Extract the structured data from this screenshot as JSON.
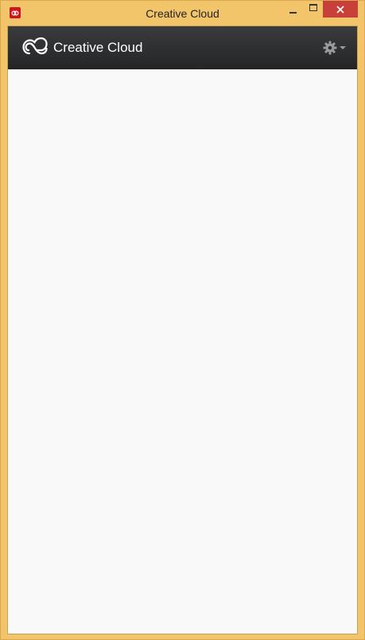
{
  "window": {
    "title": "Creative Cloud",
    "app_icon": "adobe-cc-icon",
    "controls": {
      "minimize_icon": "minimize-icon",
      "maximize_icon": "maximize-icon",
      "close_icon": "close-icon"
    }
  },
  "header": {
    "logo_icon": "creative-cloud-logo-icon",
    "title": "Creative Cloud",
    "settings_icon": "gear-icon",
    "dropdown_icon": "caret-down-icon"
  },
  "colors": {
    "window_frame": "#f3c56b",
    "close_button": "#c7403a",
    "header_bg": "#2e2f31",
    "content_bg": "#f9f9f9",
    "app_icon_red": "#d2141e"
  }
}
